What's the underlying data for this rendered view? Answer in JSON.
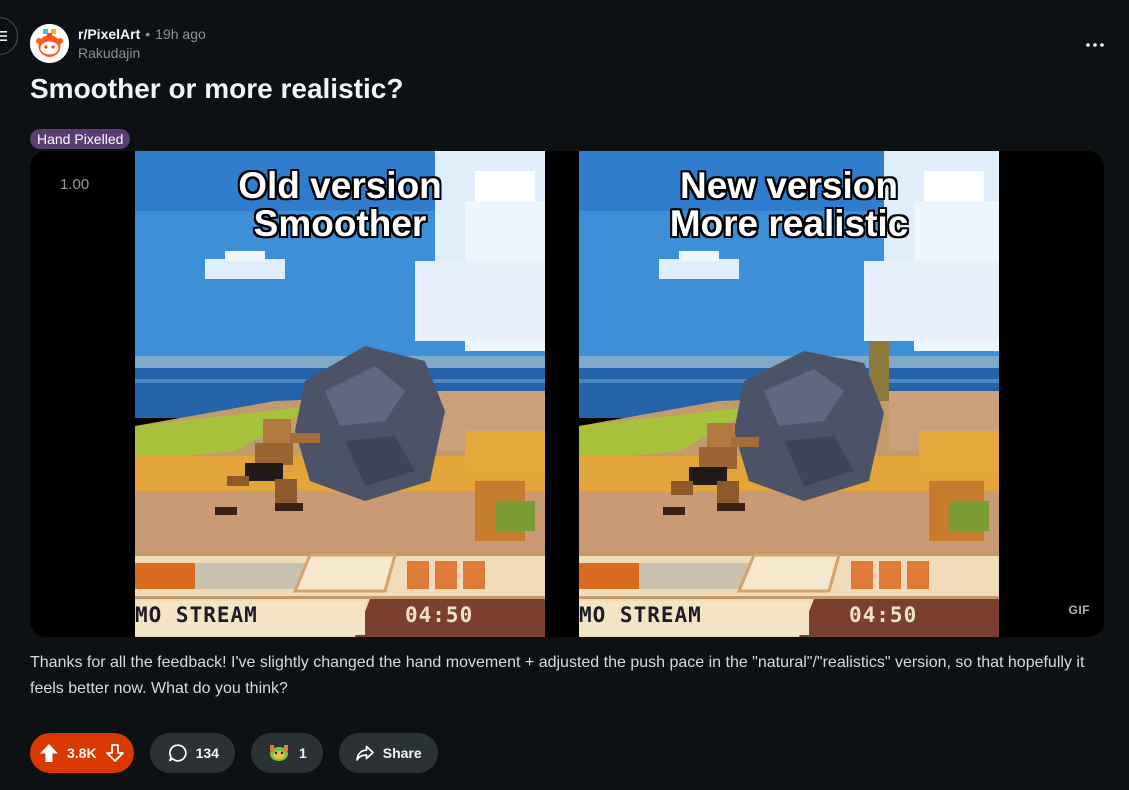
{
  "post": {
    "subreddit": "r/PixelArt",
    "separator": "•",
    "time": "19h ago",
    "author": "Rakudajin",
    "title": "Smoother or more realistic?",
    "flair": "Hand Pixelled",
    "body": "Thanks for all the feedback! I've slightly changed the hand movement + adjusted the push pace in the \"natural\"/\"realistics\" version, so that hopefully it feels better now. What do you think?"
  },
  "media": {
    "playback_speed": "1.00",
    "badge": "GIF",
    "left_panel": {
      "caption_line1": "Old version",
      "caption_line2": "Smoother",
      "hud_stream": "MO STREAM",
      "hud_timer": "04:50"
    },
    "right_panel": {
      "caption_line1": "New version",
      "caption_line2": "More realistic",
      "hud_stream": "MO STREAM",
      "hud_timer": "04:50"
    }
  },
  "actions": {
    "score": "3.8K",
    "comments": "134",
    "awards": "1",
    "share_label": "Share"
  },
  "icons": {
    "menu": "hamburger-menu-icon",
    "more": "more-options-icon",
    "upvote": "upvote-arrow-icon",
    "downvote": "downvote-arrow-icon",
    "comment": "comment-bubble-icon",
    "award": "award-icon",
    "share": "share-arrow-icon"
  },
  "colors": {
    "background": "#0e1113",
    "vote_active": "#d93900",
    "pill": "#2a3236",
    "flair": "#5a3d73",
    "muted_text": "#82959b"
  }
}
